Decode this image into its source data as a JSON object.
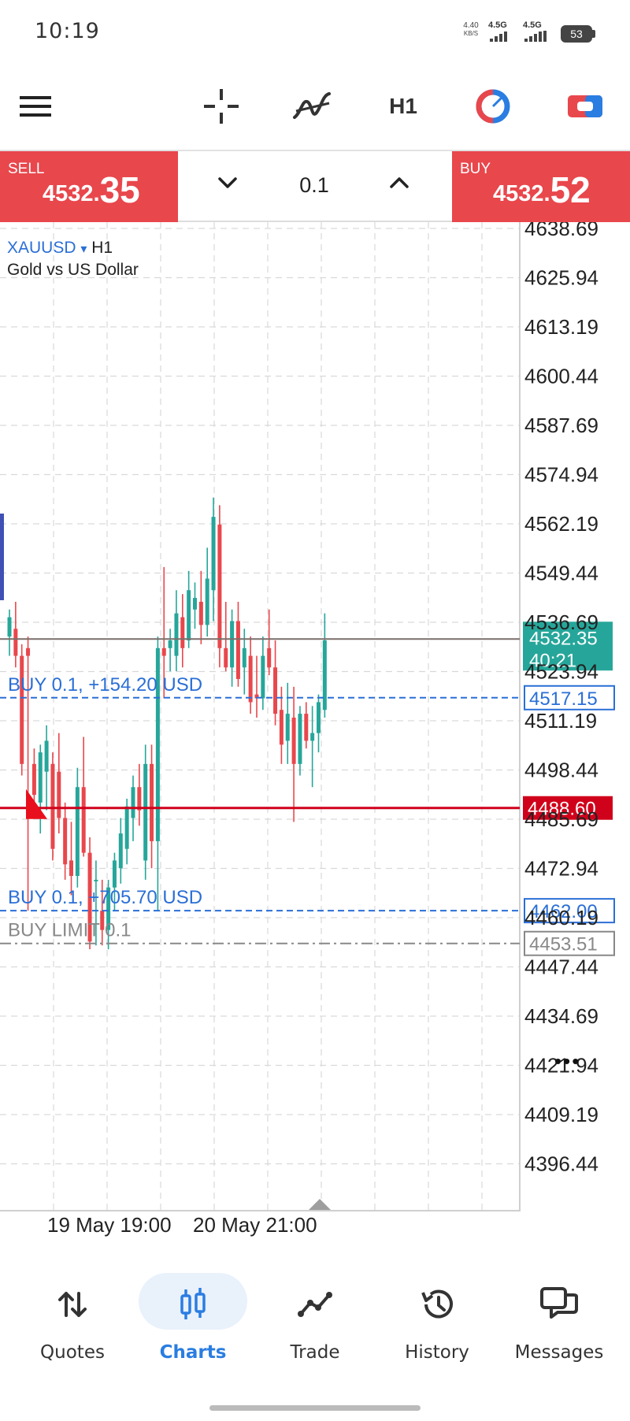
{
  "status_bar": {
    "time": "10:19",
    "net_speed_top": "4.40",
    "net_speed_unit": "KB/S",
    "signal_1": "4.5G",
    "signal_2": "4.5G",
    "battery": "53"
  },
  "toolbar": {
    "timeframe": "H1",
    "icons": [
      "menu-icon",
      "crosshair-icon",
      "indicators-icon",
      "timeframe-label",
      "chart-color-icon",
      "one-click-trading-icon"
    ]
  },
  "trade_panel": {
    "sell_label": "SELL",
    "sell_price_small": "4532.",
    "sell_price_big": "35",
    "volume": "0.1",
    "buy_label": "BUY",
    "buy_price_small": "4532.",
    "buy_price_big": "52"
  },
  "chart": {
    "symbol": "XAUUSD",
    "symbol_arrow": "▾",
    "timeframe": "H1",
    "description": "Gold vs US Dollar",
    "price_ticks": [
      "4638.69",
      "4625.94",
      "4613.19",
      "4600.44",
      "4587.69",
      "4574.94",
      "4562.19",
      "4549.44",
      "4536.69",
      "4523.94",
      "4511.19",
      "4498.44",
      "4485.69",
      "4472.94",
      "4460.19",
      "4447.44",
      "4434.69",
      "4421.94",
      "4409.19",
      "4396.44"
    ],
    "current_price": "4532.35",
    "countdown": "40:21",
    "lines": {
      "buy_order_1_label": "BUY 0.1,  +154.20 USD",
      "buy_order_1_price": "4517.15",
      "alert_price": "4488.60",
      "buy_order_2_label": "BUY 0.1,  +705.70 USD",
      "buy_order_2_price": "4462.00",
      "buy_limit_label": "BUY LIMIT 0.1",
      "buy_limit_price": "4453.51"
    },
    "colors": {
      "bull": "#26a69a",
      "bear": "#e8474c",
      "order_line": "#2a6fd6",
      "alert_line": "#d0021b",
      "bid_line": "#7a6f6a",
      "limit_line": "#888888"
    },
    "x_labels": [
      "19 May 19:00",
      "20 May 21:00"
    ],
    "more_menu": "•••"
  },
  "chart_data": {
    "type": "candlestick",
    "symbol": "XAUUSD",
    "timeframe": "H1",
    "ylim": [
      4390.06,
      4642.51
    ],
    "candles": [
      {
        "o": 4533,
        "h": 4540,
        "l": 4528,
        "c": 4538
      },
      {
        "o": 4535,
        "h": 4542,
        "l": 4525,
        "c": 4528
      },
      {
        "o": 4528,
        "h": 4531,
        "l": 4497,
        "c": 4500
      },
      {
        "o": 4530,
        "h": 4533,
        "l": 4462,
        "c": 4528
      },
      {
        "o": 4500,
        "h": 4504,
        "l": 4488,
        "c": 4492
      },
      {
        "o": 4490,
        "h": 4505,
        "l": 4482,
        "c": 4503
      },
      {
        "o": 4498,
        "h": 4510,
        "l": 4488,
        "c": 4506
      },
      {
        "o": 4500,
        "h": 4503,
        "l": 4475,
        "c": 4478
      },
      {
        "o": 4498,
        "h": 4508,
        "l": 4482,
        "c": 4486
      },
      {
        "o": 4486,
        "h": 4490,
        "l": 4470,
        "c": 4474
      },
      {
        "o": 4475,
        "h": 4485,
        "l": 4466,
        "c": 4471
      },
      {
        "o": 4471,
        "h": 4499,
        "l": 4468,
        "c": 4494
      },
      {
        "o": 4494,
        "h": 4507,
        "l": 4476,
        "c": 4477
      },
      {
        "o": 4477,
        "h": 4481,
        "l": 4452,
        "c": 4454
      },
      {
        "o": 4470,
        "h": 4475,
        "l": 4453,
        "c": 4470
      },
      {
        "o": 4462,
        "h": 4470,
        "l": 4453,
        "c": 4457
      },
      {
        "o": 4457,
        "h": 4470,
        "l": 4452,
        "c": 4468
      },
      {
        "o": 4468,
        "h": 4477,
        "l": 4462,
        "c": 4475
      },
      {
        "o": 4473,
        "h": 4486,
        "l": 4469,
        "c": 4482
      },
      {
        "o": 4478,
        "h": 4491,
        "l": 4474,
        "c": 4489
      },
      {
        "o": 4486,
        "h": 4497,
        "l": 4480,
        "c": 4494
      },
      {
        "o": 4494,
        "h": 4500,
        "l": 4484,
        "c": 4488
      },
      {
        "o": 4475,
        "h": 4505,
        "l": 4470,
        "c": 4500
      },
      {
        "o": 4500,
        "h": 4505,
        "l": 4473,
        "c": 4480
      },
      {
        "o": 4480,
        "h": 4533,
        "l": 4462,
        "c": 4530
      },
      {
        "o": 4530,
        "h": 4551,
        "l": 4517,
        "c": 4528
      },
      {
        "o": 4530,
        "h": 4535,
        "l": 4524,
        "c": 4532
      },
      {
        "o": 4528,
        "h": 4545,
        "l": 4524,
        "c": 4539
      },
      {
        "o": 4538,
        "h": 4544,
        "l": 4525,
        "c": 4530
      },
      {
        "o": 4532,
        "h": 4550,
        "l": 4530,
        "c": 4545
      },
      {
        "o": 4540,
        "h": 4547,
        "l": 4535,
        "c": 4543
      },
      {
        "o": 4542,
        "h": 4550,
        "l": 4531,
        "c": 4536
      },
      {
        "o": 4536,
        "h": 4556,
        "l": 4533,
        "c": 4548
      },
      {
        "o": 4545,
        "h": 4569,
        "l": 4537,
        "c": 4564
      },
      {
        "o": 4562,
        "h": 4567,
        "l": 4525,
        "c": 4530
      },
      {
        "o": 4530,
        "h": 4542,
        "l": 4524,
        "c": 4525
      },
      {
        "o": 4525,
        "h": 4540,
        "l": 4520,
        "c": 4537
      },
      {
        "o": 4537,
        "h": 4542,
        "l": 4520,
        "c": 4522
      },
      {
        "o": 4525,
        "h": 4535,
        "l": 4518,
        "c": 4530
      },
      {
        "o": 4528,
        "h": 4533,
        "l": 4513,
        "c": 4516
      },
      {
        "o": 4518,
        "h": 4528,
        "l": 4512,
        "c": 4517
      },
      {
        "o": 4517,
        "h": 4533,
        "l": 4514,
        "c": 4528
      },
      {
        "o": 4530,
        "h": 4540,
        "l": 4523,
        "c": 4525
      },
      {
        "o": 4525,
        "h": 4532,
        "l": 4510,
        "c": 4513
      },
      {
        "o": 4514,
        "h": 4520,
        "l": 4500,
        "c": 4505
      },
      {
        "o": 4506,
        "h": 4521,
        "l": 4500,
        "c": 4513
      },
      {
        "o": 4512,
        "h": 4520,
        "l": 4485,
        "c": 4500
      },
      {
        "o": 4500,
        "h": 4515,
        "l": 4497,
        "c": 4513
      },
      {
        "o": 4513,
        "h": 4516,
        "l": 4504,
        "c": 4506
      },
      {
        "o": 4506,
        "h": 4515,
        "l": 4494,
        "c": 4508
      },
      {
        "o": 4508,
        "h": 4518,
        "l": 4503,
        "c": 4516
      },
      {
        "o": 4514,
        "h": 4539,
        "l": 4512,
        "c": 4532
      }
    ]
  },
  "bottom_nav": {
    "items": [
      {
        "label": "Quotes",
        "icon": "quotes-icon"
      },
      {
        "label": "Charts",
        "icon": "charts-icon"
      },
      {
        "label": "Trade",
        "icon": "trade-icon"
      },
      {
        "label": "History",
        "icon": "history-icon"
      },
      {
        "label": "Messages",
        "icon": "messages-icon"
      }
    ],
    "active": "Charts"
  }
}
